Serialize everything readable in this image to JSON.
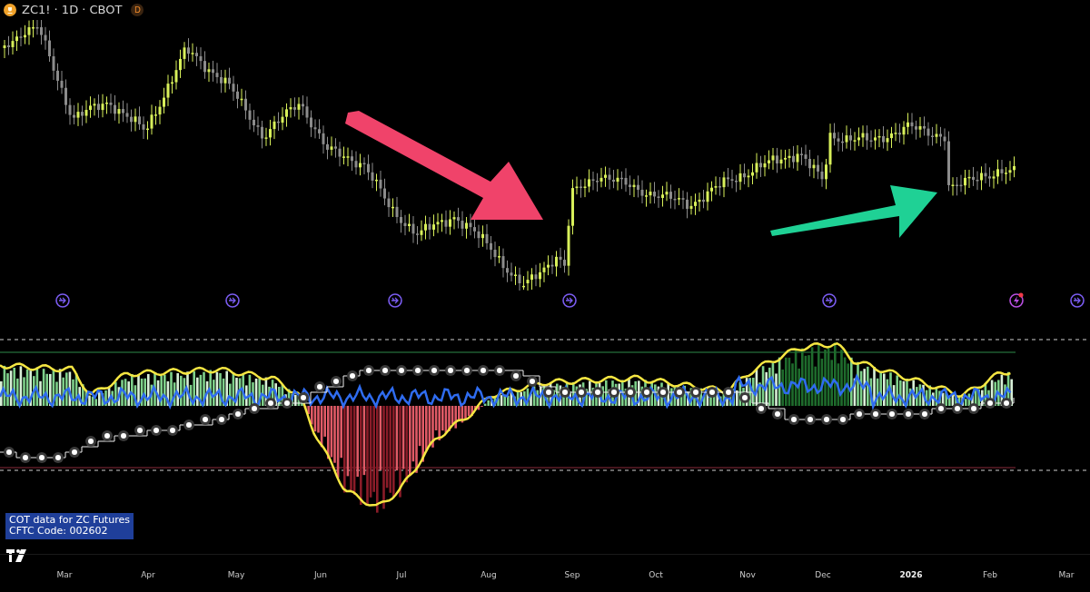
{
  "header": {
    "symbol": "ZC1! · 1D · CBOT",
    "badge": "D"
  },
  "legend": {
    "lines": [
      "COT data for ZC Futures",
      "CFTC Code: 002602"
    ]
  },
  "x_axis": {
    "labels": [
      {
        "text": "Mar",
        "kind": "month"
      },
      {
        "text": "Apr",
        "kind": "month"
      },
      {
        "text": "May",
        "kind": "month"
      },
      {
        "text": "Jun",
        "kind": "month"
      },
      {
        "text": "Jul",
        "kind": "month"
      },
      {
        "text": "Aug",
        "kind": "month"
      },
      {
        "text": "Sep",
        "kind": "month"
      },
      {
        "text": "Oct",
        "kind": "month"
      },
      {
        "text": "Nov",
        "kind": "month"
      },
      {
        "text": "Dec",
        "kind": "month"
      },
      {
        "text": "2026",
        "kind": "year"
      },
      {
        "text": "Feb",
        "kind": "month"
      },
      {
        "text": "Mar",
        "kind": "month"
      }
    ]
  }
}
